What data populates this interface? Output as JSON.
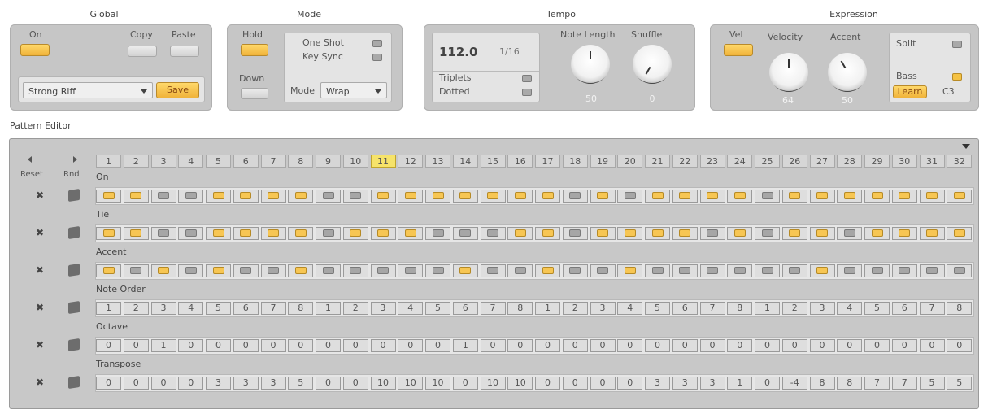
{
  "sections": {
    "global": "Global",
    "mode": "Mode",
    "tempo": "Tempo",
    "expression": "Expression",
    "pattern_editor": "Pattern Editor"
  },
  "global": {
    "on_label": "On",
    "copy_label": "Copy",
    "paste_label": "Paste",
    "preset_value": "Strong Riff",
    "save_label": "Save"
  },
  "mode": {
    "hold_label": "Hold",
    "down_label": "Down",
    "one_shot_label": "One Shot",
    "key_sync_label": "Key Sync",
    "mode_label": "Mode",
    "mode_value": "Wrap"
  },
  "tempo": {
    "bpm": "112.0",
    "rate": "1/16",
    "triplets_label": "Triplets",
    "dotted_label": "Dotted",
    "note_length_label": "Note Length",
    "note_length_value": "50",
    "shuffle_label": "Shuffle",
    "shuffle_value": "0"
  },
  "expression": {
    "vel_label": "Vel",
    "velocity_label": "Velocity",
    "velocity_value": "64",
    "accent_label": "Accent",
    "accent_value": "50",
    "split_label": "Split",
    "bass_label": "Bass",
    "learn_label": "Learn",
    "note_value": "C3"
  },
  "pattern": {
    "reset_label": "Reset",
    "rnd_label": "Rnd",
    "current_step": 11,
    "steps": [
      "1",
      "2",
      "3",
      "4",
      "5",
      "6",
      "7",
      "8",
      "9",
      "10",
      "11",
      "12",
      "13",
      "14",
      "15",
      "16",
      "17",
      "18",
      "19",
      "20",
      "21",
      "22",
      "23",
      "24",
      "25",
      "26",
      "27",
      "28",
      "29",
      "30",
      "31",
      "32"
    ],
    "rows": [
      {
        "label": "On",
        "kind": "toggle",
        "values": [
          1,
          1,
          0,
          0,
          1,
          1,
          1,
          1,
          0,
          0,
          1,
          1,
          1,
          1,
          1,
          1,
          1,
          0,
          1,
          0,
          1,
          1,
          1,
          1,
          0,
          1,
          1,
          1,
          1,
          1,
          1,
          1
        ]
      },
      {
        "label": "Tie",
        "kind": "toggle",
        "values": [
          1,
          1,
          0,
          0,
          1,
          1,
          1,
          1,
          0,
          1,
          1,
          1,
          0,
          0,
          0,
          1,
          1,
          0,
          1,
          1,
          1,
          1,
          0,
          1,
          0,
          1,
          1,
          0,
          1,
          1,
          1,
          1
        ]
      },
      {
        "label": "Accent",
        "kind": "toggle",
        "values": [
          1,
          0,
          1,
          0,
          1,
          0,
          0,
          1,
          0,
          0,
          0,
          0,
          0,
          1,
          0,
          0,
          1,
          0,
          0,
          1,
          0,
          0,
          0,
          0,
          0,
          0,
          1,
          0,
          0,
          0,
          0,
          0
        ]
      },
      {
        "label": "Note Order",
        "kind": "value",
        "values": [
          "1",
          "2",
          "3",
          "4",
          "5",
          "6",
          "7",
          "8",
          "1",
          "2",
          "3",
          "4",
          "5",
          "6",
          "7",
          "8",
          "1",
          "2",
          "3",
          "4",
          "5",
          "6",
          "7",
          "8",
          "1",
          "2",
          "3",
          "4",
          "5",
          "6",
          "7",
          "8"
        ]
      },
      {
        "label": "Octave",
        "kind": "value",
        "values": [
          "0",
          "0",
          "1",
          "0",
          "0",
          "0",
          "0",
          "0",
          "0",
          "0",
          "0",
          "0",
          "0",
          "1",
          "0",
          "0",
          "0",
          "0",
          "0",
          "0",
          "0",
          "0",
          "0",
          "0",
          "0",
          "0",
          "0",
          "0",
          "0",
          "0",
          "0",
          "0"
        ]
      },
      {
        "label": "Transpose",
        "kind": "value",
        "values": [
          "0",
          "0",
          "0",
          "0",
          "3",
          "3",
          "3",
          "5",
          "0",
          "0",
          "10",
          "10",
          "10",
          "0",
          "10",
          "10",
          "0",
          "0",
          "0",
          "0",
          "3",
          "3",
          "3",
          "1",
          "0",
          "-4",
          "8",
          "8",
          "7",
          "7",
          "5",
          "5"
        ]
      }
    ]
  }
}
